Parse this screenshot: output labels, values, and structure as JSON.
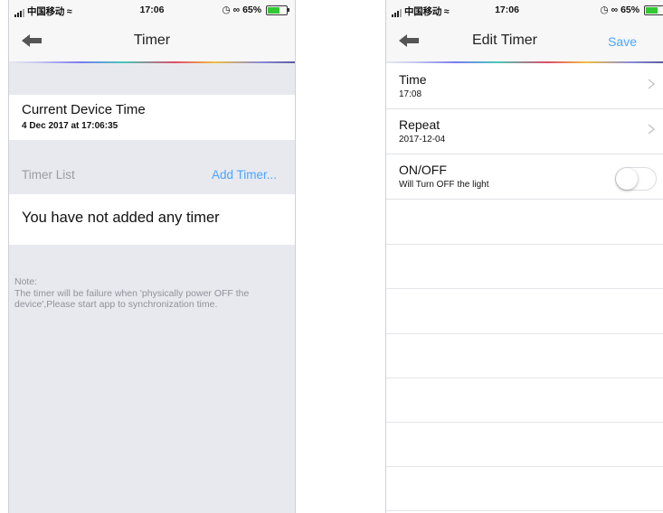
{
  "left": {
    "status": {
      "carrier": "中国移动",
      "time": "17:06",
      "battery": "65%"
    },
    "nav": {
      "title": "Timer"
    },
    "current_time": {
      "title": "Current Device Time",
      "value": "4 Dec 2017 at 17:06:35"
    },
    "timer_list": {
      "label": "Timer List",
      "add_label": "Add Timer..."
    },
    "empty_message": "You have not added any timer",
    "note": "Note:\nThe timer will be failure when 'physically power OFF the device',Please start app to synchronization time."
  },
  "right": {
    "status": {
      "carrier": "中国移动",
      "time": "17:06",
      "battery": "65%"
    },
    "nav": {
      "title": "Edit Timer",
      "save_label": "Save"
    },
    "rows": [
      {
        "title": "Time",
        "subtitle": "17:08"
      },
      {
        "title": "Repeat",
        "subtitle": "2017-12-04"
      },
      {
        "title": "ON/OFF",
        "subtitle": "Will Turn OFF the light",
        "toggle_on": false
      }
    ]
  },
  "colors": {
    "accent": "#4aa6ff",
    "background": "#e8e9ee",
    "battery_fill": "#32c832"
  }
}
